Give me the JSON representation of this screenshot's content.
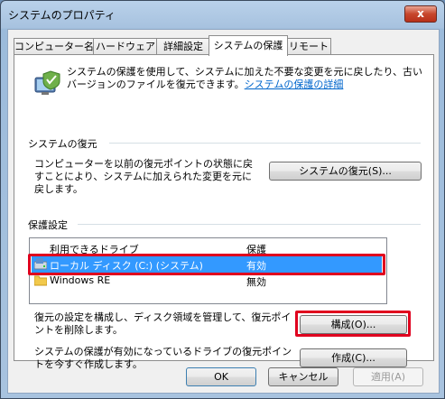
{
  "window": {
    "title": "システムのプロパティ",
    "close_glyph": "x"
  },
  "tabs": [
    {
      "label": "コンピューター名"
    },
    {
      "label": "ハードウェア"
    },
    {
      "label": "詳細設定"
    },
    {
      "label": "システムの保護"
    },
    {
      "label": "リモート"
    }
  ],
  "protection": {
    "description": "システムの保護を使用して、システムに加えた不要な変更を元に戻したり、古いバージョンのファイルを復元できます。",
    "link": "システムの保護の詳細"
  },
  "restore": {
    "section_title": "システムの復元",
    "text": "コンピューターを以前の復元ポイントの状態に戻すことにより、システムに加えられた変更を元に戻します。",
    "button": "システムの復元(S)..."
  },
  "settings": {
    "section_title": "保護設定",
    "columns": {
      "drive": "利用できるドライブ",
      "protection": "保護"
    },
    "drives": [
      {
        "name": "ローカル ディスク (C:) (システム)",
        "status": "有効"
      },
      {
        "name": "Windows RE",
        "status": "無効"
      }
    ],
    "configure_text": "復元の設定を構成し、ディスク領域を管理して、復元ポイントを削除します。",
    "configure_button": "構成(O)...",
    "create_text": "システムの保護が有効になっているドライブの復元ポイントを今すぐ作成します。",
    "create_button": "作成(C)..."
  },
  "buttons": {
    "ok": "OK",
    "cancel": "キャンセル",
    "apply": "適用(A)"
  },
  "colors": {
    "highlight": "#e0001e",
    "selection": "#3399ff",
    "link": "#0066cc"
  }
}
